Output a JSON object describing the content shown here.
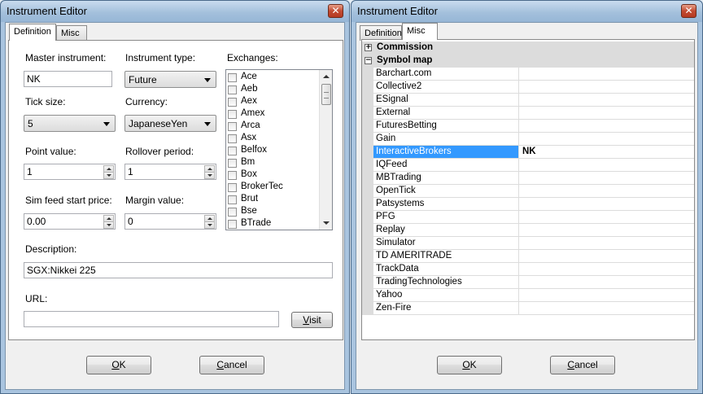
{
  "left_window": {
    "title": "Instrument Editor",
    "close_glyph": "✕",
    "tabs": [
      {
        "label": "Definition"
      },
      {
        "label": "Misc"
      }
    ],
    "fields": {
      "master_instrument": {
        "label": "Master instrument:",
        "value": "NK"
      },
      "instrument_type": {
        "label": "Instrument type:",
        "value": "Future"
      },
      "tick_size": {
        "label": "Tick size:",
        "value": "5"
      },
      "currency": {
        "label": "Currency:",
        "value": "JapaneseYen"
      },
      "point_value": {
        "label": "Point value:",
        "value": "1"
      },
      "rollover_period": {
        "label": "Rollover period:",
        "value": "1"
      },
      "sim_feed_start_price": {
        "label": "Sim feed start price:",
        "value": "0.00"
      },
      "margin_value": {
        "label": "Margin value:",
        "value": "0"
      },
      "description": {
        "label": "Description:",
        "value": "SGX:Nikkei 225"
      },
      "url": {
        "label": "URL:",
        "value": ""
      }
    },
    "exchanges_label": "Exchanges:",
    "exchanges": [
      "Ace",
      "Aeb",
      "Aex",
      "Amex",
      "Arca",
      "Asx",
      "Belfox",
      "Bm",
      "Box",
      "BrokerTec",
      "Brut",
      "Bse",
      "BTrade"
    ],
    "visit_button": {
      "underline": "V",
      "rest": "isit"
    },
    "ok_button": {
      "underline": "O",
      "rest": "K"
    },
    "cancel_button": {
      "underline": "C",
      "rest": "ancel"
    }
  },
  "right_window": {
    "title": "Instrument Editor",
    "close_glyph": "✕",
    "tabs": [
      {
        "label": "Definition"
      },
      {
        "label": "Misc"
      }
    ],
    "categories": [
      {
        "label": "Commission",
        "expander": "+"
      },
      {
        "label": "Symbol map",
        "expander": "−"
      }
    ],
    "symbol_map": [
      {
        "name": "Barchart.com",
        "value": ""
      },
      {
        "name": "Collective2",
        "value": ""
      },
      {
        "name": "ESignal",
        "value": ""
      },
      {
        "name": "External",
        "value": ""
      },
      {
        "name": "FuturesBetting",
        "value": ""
      },
      {
        "name": "Gain",
        "value": ""
      },
      {
        "name": "InteractiveBrokers",
        "value": "NK",
        "selected": true
      },
      {
        "name": "IQFeed",
        "value": ""
      },
      {
        "name": "MBTrading",
        "value": ""
      },
      {
        "name": "OpenTick",
        "value": ""
      },
      {
        "name": "Patsystems",
        "value": ""
      },
      {
        "name": "PFG",
        "value": ""
      },
      {
        "name": "Replay",
        "value": ""
      },
      {
        "name": "Simulator",
        "value": ""
      },
      {
        "name": "TD AMERITRADE",
        "value": ""
      },
      {
        "name": "TrackData",
        "value": ""
      },
      {
        "name": "TradingTechnologies",
        "value": ""
      },
      {
        "name": "Yahoo",
        "value": ""
      },
      {
        "name": "Zen-Fire",
        "value": ""
      }
    ],
    "ok_button": {
      "underline": "O",
      "rest": "K"
    },
    "cancel_button": {
      "underline": "C",
      "rest": "ancel"
    }
  },
  "colors": {
    "selection": "#3399ff",
    "titlebar": "#a4c0dc",
    "close": "#c24b32"
  }
}
